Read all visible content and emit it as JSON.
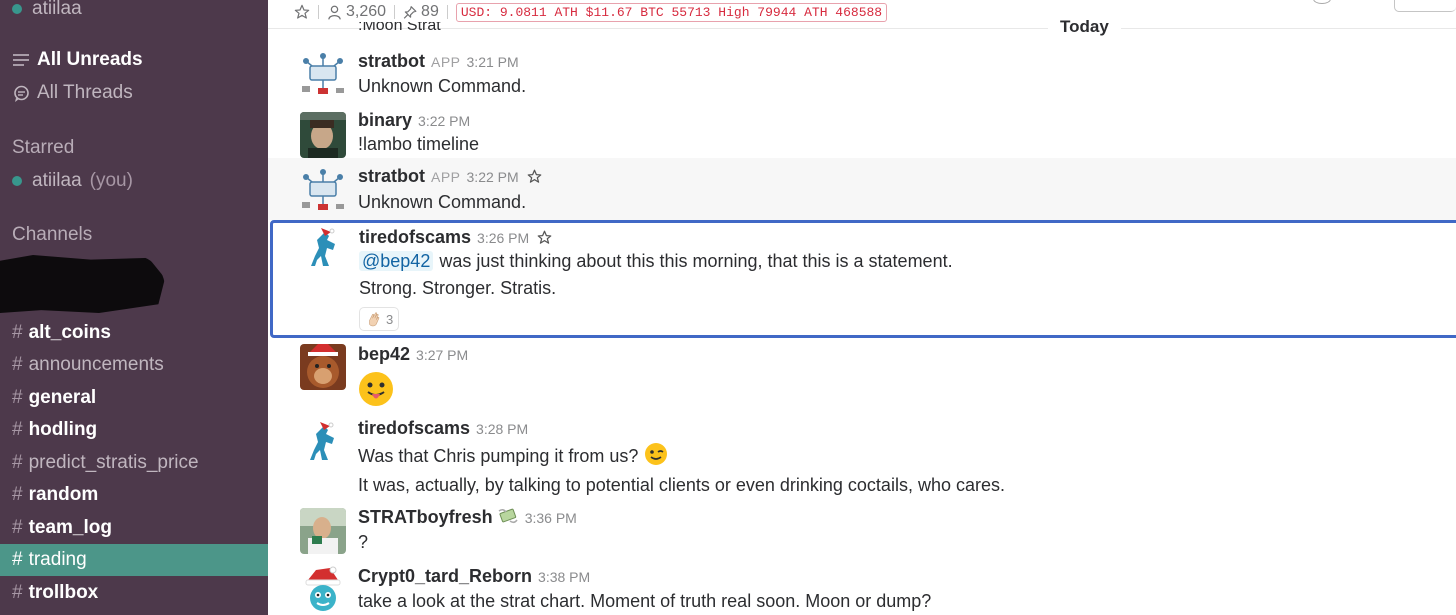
{
  "sidebar": {
    "current_user": "atiilaa",
    "all_unreads": "All Unreads",
    "all_threads": "All Threads",
    "starred_header": "Starred",
    "starred_user": "atiilaa",
    "you_label": "(you)",
    "channels_header": "Channels",
    "channels": [
      {
        "name": "alt_coins",
        "unread": true
      },
      {
        "name": "announcements",
        "unread": false
      },
      {
        "name": "general",
        "unread": true
      },
      {
        "name": "hodling",
        "unread": true
      },
      {
        "name": "predict_stratis_price",
        "unread": false
      },
      {
        "name": "random",
        "unread": true
      },
      {
        "name": "team_log",
        "unread": true
      },
      {
        "name": "trading",
        "unread": false,
        "active": true
      },
      {
        "name": "trollbox",
        "unread": true
      }
    ]
  },
  "header": {
    "members": "3,260",
    "pinned": "89",
    "ticker": "USD: 9.0811 ATH $11.67 BTC 55713 High 79944 ATH 468588"
  },
  "day_divider": "Today",
  "clipped_message": ":Moon Strat",
  "messages": [
    {
      "author": "stratbot",
      "app": "APP",
      "time": "3:21 PM",
      "text": "Unknown Command."
    },
    {
      "author": "binary",
      "time": "3:22 PM",
      "text": "!lambo timeline"
    },
    {
      "author": "stratbot",
      "app": "APP",
      "time": "3:22 PM",
      "text": "Unknown Command."
    },
    {
      "author": "tiredofscams",
      "time": "3:26 PM",
      "mention": "@bep42",
      "text": "was just thinking about this this morning, that this is a statement.",
      "text2": "Strong. Stronger. Stratis.",
      "reaction_count": "3"
    },
    {
      "author": "bep42",
      "time": "3:27 PM"
    },
    {
      "author": "tiredofscams",
      "time": "3:28 PM",
      "text": "Was that Chris pumping it from us?",
      "text2": "It was, actually, by talking to potential clients or even drinking coctails, who cares."
    },
    {
      "author": "STRATboyfresh",
      "time": "3:36 PM",
      "text": "?"
    },
    {
      "author": "Crypt0_tard_Reborn",
      "time": "3:38 PM",
      "text": "take a look at the strat chart.  Moment of truth real soon.  Moon or dump?"
    }
  ],
  "colors": {
    "sidebar_bg": "#4d394b",
    "active_channel": "#4c9689",
    "presence": "#38978d",
    "selection_border": "#4068c6",
    "ticker_red": "#d72b3f"
  }
}
